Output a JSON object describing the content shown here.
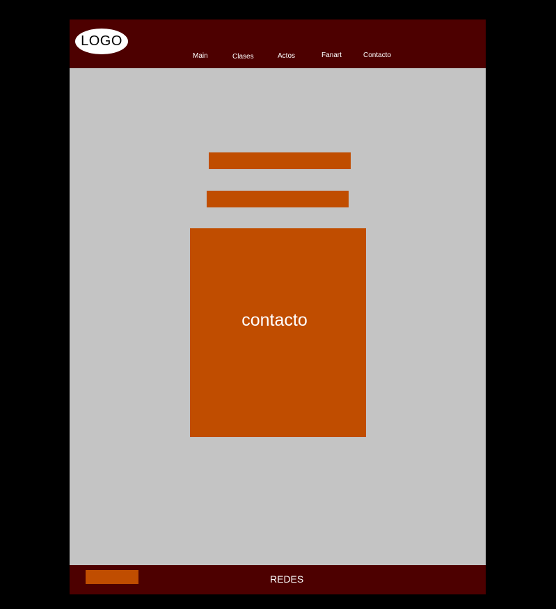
{
  "header": {
    "logo_label": "LOGO",
    "nav": [
      {
        "label": "Main"
      },
      {
        "label": "Clases"
      },
      {
        "label": "Actos"
      },
      {
        "label": "Fanart"
      },
      {
        "label": "Contacto"
      }
    ]
  },
  "main": {
    "contact_label": "contacto"
  },
  "footer": {
    "label": "REDES"
  },
  "colors": {
    "background": "#000000",
    "page": "#c4c4c4",
    "header": "#4d0000",
    "accent": "#c04d00",
    "text_light": "#ffffff"
  }
}
